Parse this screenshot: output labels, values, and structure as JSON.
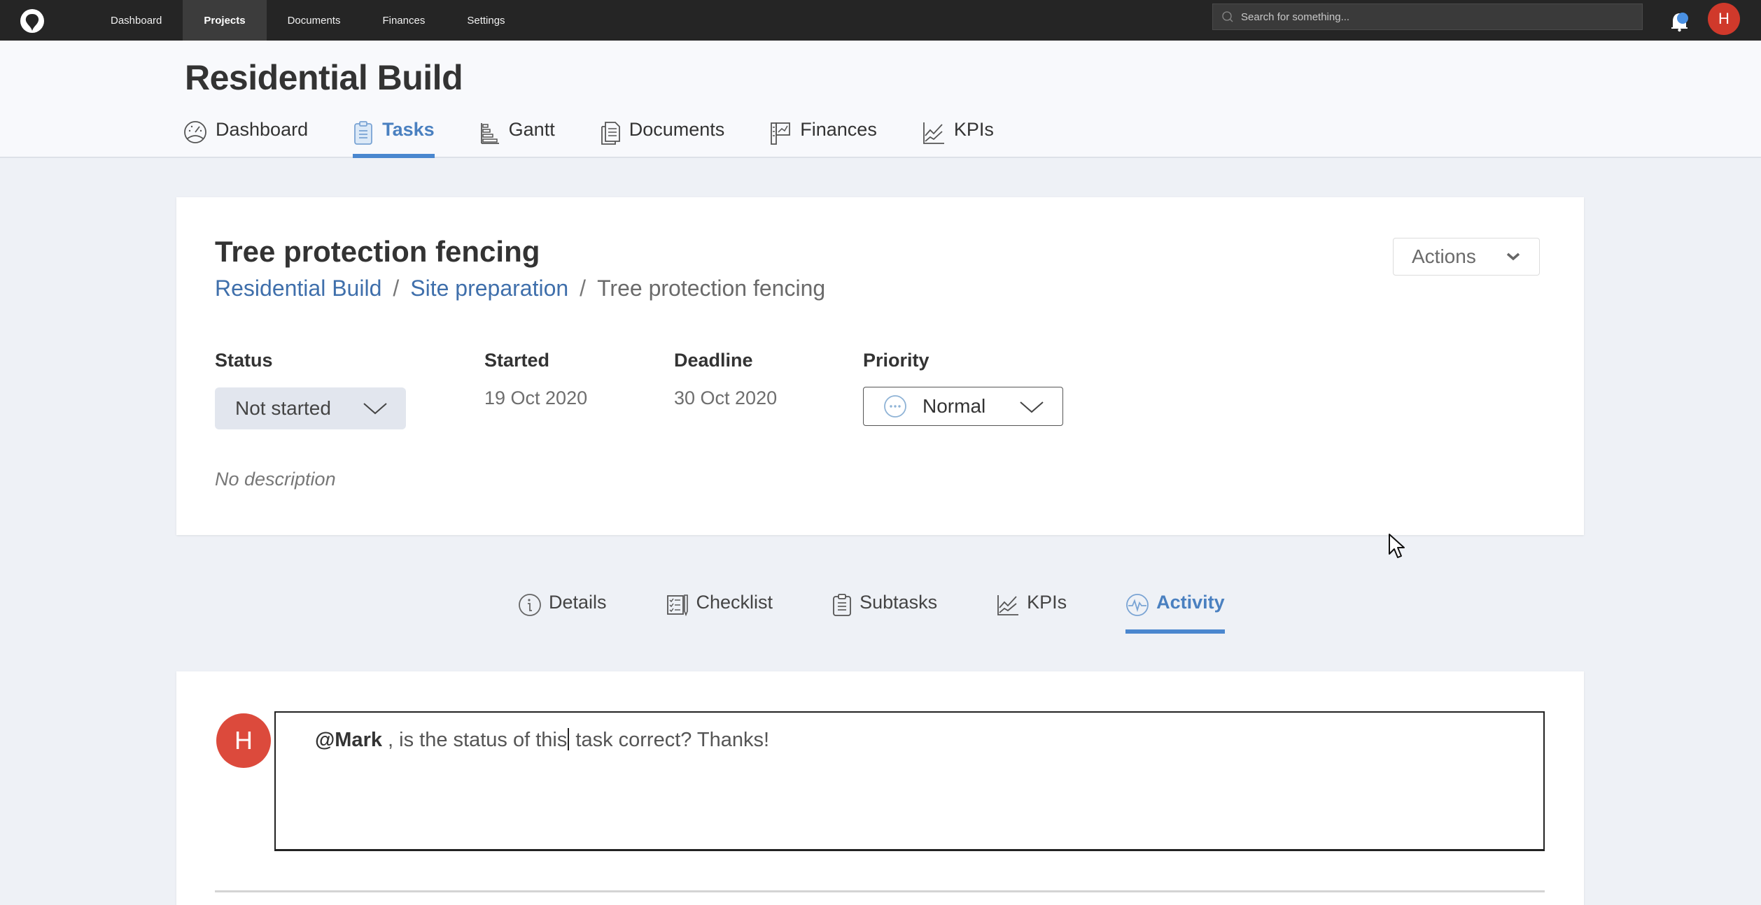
{
  "topbar": {
    "logo": "app-logo",
    "nav": [
      {
        "label": "Dashboard",
        "active": false
      },
      {
        "label": "Projects",
        "active": true
      },
      {
        "label": "Documents",
        "active": false
      },
      {
        "label": "Finances",
        "active": false
      },
      {
        "label": "Settings",
        "active": false
      }
    ],
    "search_placeholder": "Search for something...",
    "notification_icon": "bell-icon",
    "user_initial": "H"
  },
  "project": {
    "title": "Residential Build",
    "tabs": [
      {
        "label": "Dashboard",
        "icon": "gauge-icon",
        "active": false
      },
      {
        "label": "Tasks",
        "icon": "clipboard-icon",
        "active": true
      },
      {
        "label": "Gantt",
        "icon": "gantt-icon",
        "active": false
      },
      {
        "label": "Documents",
        "icon": "document-icon",
        "active": false
      },
      {
        "label": "Finances",
        "icon": "finances-icon",
        "active": false
      },
      {
        "label": "KPIs",
        "icon": "chart-line-icon",
        "active": false
      }
    ]
  },
  "task": {
    "title": "Tree protection fencing",
    "breadcrumb": [
      {
        "label": "Residential Build",
        "link": true
      },
      {
        "label": "Site preparation",
        "link": true
      },
      {
        "label": "Tree protection fencing",
        "link": false
      }
    ],
    "breadcrumb_separator": "/",
    "actions_label": "Actions",
    "status": {
      "label": "Status",
      "value": "Not started"
    },
    "started": {
      "label": "Started",
      "value": "19 Oct 2020"
    },
    "deadline": {
      "label": "Deadline",
      "value": "30 Oct 2020"
    },
    "priority": {
      "label": "Priority",
      "value": "Normal"
    },
    "description": "No description"
  },
  "task_tabs": [
    {
      "label": "Details",
      "icon": "info-icon",
      "active": false
    },
    {
      "label": "Checklist",
      "icon": "checklist-icon",
      "active": false
    },
    {
      "label": "Subtasks",
      "icon": "clipboard-icon",
      "active": false
    },
    {
      "label": "KPIs",
      "icon": "chart-line-icon",
      "active": false
    },
    {
      "label": "Activity",
      "icon": "activity-icon",
      "active": true
    }
  ],
  "activity": {
    "avatar_initial": "H",
    "comment": {
      "mention": "@Mark",
      "text_before_caret": " , is the status of this",
      "text_after_caret": " task correct? Thanks!"
    }
  },
  "colors": {
    "accent": "#4a87cf",
    "topbar": "#252525",
    "avatar": "#d0392b",
    "link": "#3f6fab"
  }
}
